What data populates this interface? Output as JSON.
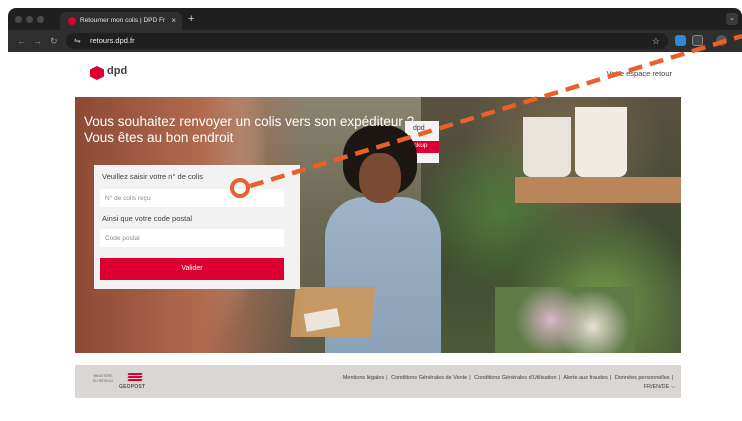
{
  "browser": {
    "tab_title": "Retourner mon colis | DPD Fr",
    "tab_close": "×",
    "new_tab": "+",
    "url": "retours.dpd.fr",
    "menu_glyph": "⌄"
  },
  "header": {
    "logo_text": "dpd",
    "space_link": "Votre espace retour"
  },
  "hero": {
    "title_line1": "Vous souhaitez renvoyer un colis vers son expéditeur ?",
    "title_line2": "Vous êtes au bon endroit",
    "sign_text": "dpd",
    "pickup_text": "Pickup"
  },
  "form": {
    "parcel_label": "Veuillez saisir votre n° de colis",
    "parcel_placeholder": "N° de colis reçu",
    "postal_label": "Ainsi que votre code postal",
    "postal_placeholder": "Code postal",
    "submit_label": "Valider"
  },
  "footer": {
    "ministry": "MINISTÈRE DU RÉSEAU",
    "group_logo": "GEOPOST",
    "links": [
      "Mentions légales",
      "Conditions Générales de Vente",
      "Conditions Générales d'Utilisation",
      "Alerte aux fraudes",
      "Données personnelles"
    ],
    "languages": "FR/EN/DE"
  },
  "annotation": {
    "color": "#e8602a"
  }
}
